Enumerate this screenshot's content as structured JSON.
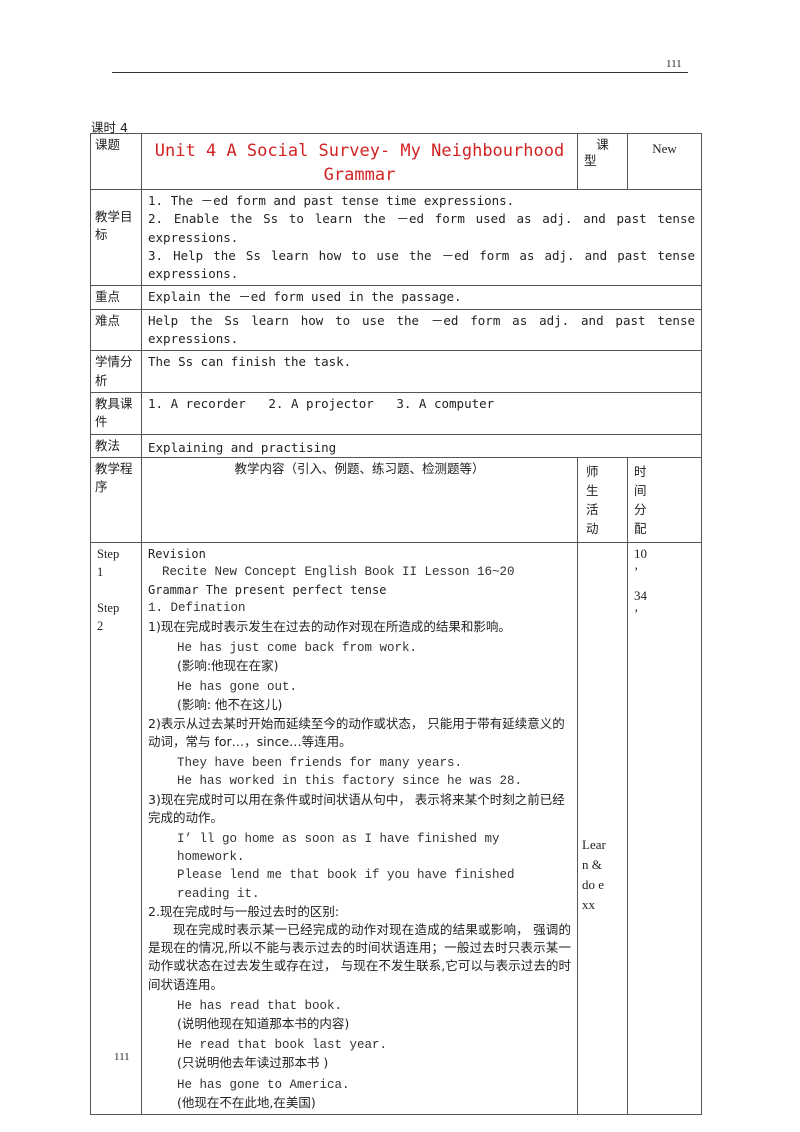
{
  "page": {
    "page_number_top": "111",
    "page_number_bottom": "111",
    "lesson_label": "课时",
    "lesson_number": "4"
  },
  "header_row": {
    "topic_label": "课题",
    "title_line1": "Unit 4 A Social Survey- My Neighbourhood",
    "title_line2": "Grammar",
    "type_label_1": "课",
    "type_label_2": "型",
    "type_value": "New",
    "title_color": "#d32222"
  },
  "objectives": {
    "label": "教学目标",
    "items": [
      "1. The －ed form and past tense time expressions.",
      "2. Enable the Ss to learn the －ed form used as adj. and past tense expressions.",
      "3. Help the Ss learn how to use the －ed form as adj. and past tense expressions."
    ]
  },
  "key_point": {
    "label": "重点",
    "text": "Explain the －ed form used in the passage."
  },
  "difficulty": {
    "label": "难点",
    "text": "Help the Ss learn how to use the －ed form as adj. and past tense expressions."
  },
  "analysis": {
    "label": "学情分析",
    "text": "The Ss can finish the task."
  },
  "tools": {
    "label": "教具课件",
    "text": "1. A recorder   2. A projector   3. A computer"
  },
  "method": {
    "label": "教法",
    "text": "Explaining and practising"
  },
  "procedure_header": {
    "label": "教学程序",
    "content_label": "教学内容（引入、例题、练习题、检测题等）",
    "activity_label": "师生活动",
    "time_label": "时间分配"
  },
  "procedure": {
    "steps": [
      "Step 1",
      "Step 2"
    ],
    "activity": "Learn & do exx",
    "times": [
      "10 ’",
      "34 ’"
    ],
    "content": {
      "revision_title": "Revision",
      "revision_text": "Recite New Concept English Book II Lesson 16~20",
      "grammar_title": "Grammar The present perfect tense",
      "definition_title": "1. Defination",
      "point1": "1)现在完成时表示发生在过去的动作对现在所造成的结果和影响。",
      "ex1_en": "He has just come back from work.",
      "ex1_cn": "(影响:他现在在家)",
      "ex2_en": "He has gone out.",
      "ex2_cn": "(影响: 他不在这儿)",
      "point2": "2)表示从过去某时开始而延续至今的动作或状态，  只能用于带有延续意义的动词，常与 for…，since…等连用。",
      "ex3_en": "They have been friends for many years.",
      "ex4_en": "He has worked in this factory since he was 28.",
      "point3": "3)现在完成时可以用在条件或时间状语从句中，  表示将来某个时刻之前已经完成的动作。",
      "ex5_en": "I’ ll go home as soon as I have finished my homework.",
      "ex6_en": "Please lend me that book if you have finished reading it.",
      "diff_title": "2.现在完成时与一般过去时的区别:",
      "diff_text": "现在完成时表示某一已经完成的动作对现在造成的结果或影响，  强调的是现在的情况,所以不能与表示过去的时间状语连用；一般过去时只表示某一动作或状态在过去发生或存在过，  与现在不发生联系,它可以与表示过去的时间状语连用。",
      "ex7_en": "He has read that book.",
      "ex7_cn": "(说明他现在知道那本书的内容)",
      "ex8_en": "He read that book last year.",
      "ex8_cn": "(只说明他去年读过那本书 )",
      "ex9_en": "He has gone to America.",
      "ex9_cn": "(他现在不在此地,在美国)"
    }
  }
}
